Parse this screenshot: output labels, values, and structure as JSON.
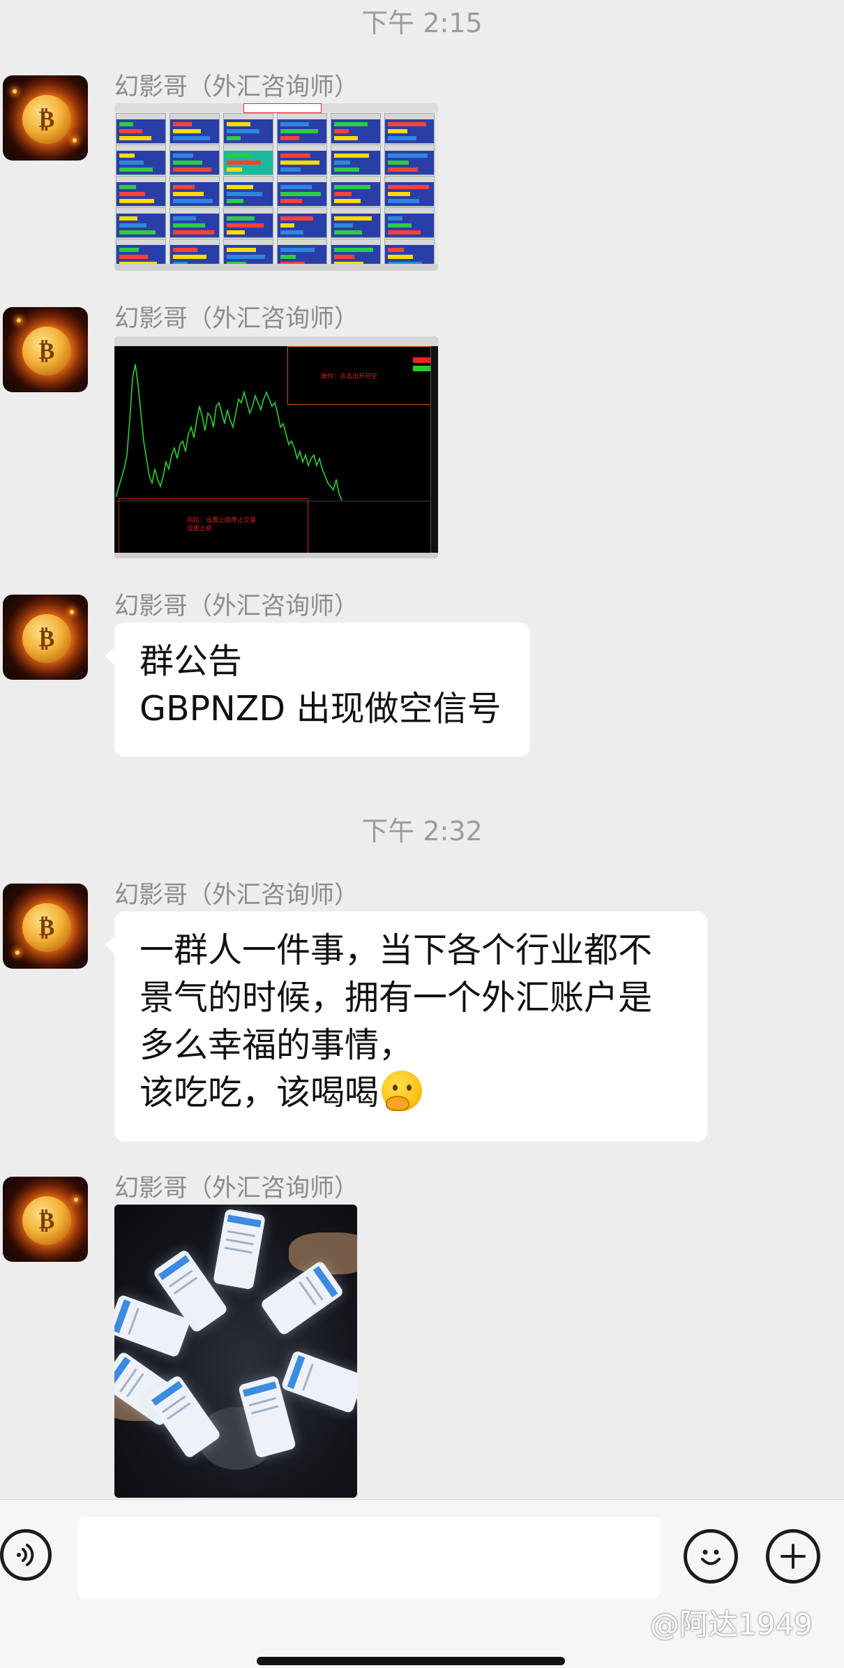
{
  "app": {
    "name": "WeChat group chat"
  },
  "colors": {
    "background": "#ededed",
    "bubble": "#ffffff",
    "timestamp": "#9b9b9b",
    "sender": "#8c8c8c"
  },
  "messages": {
    "ts1": "下午 2:15",
    "ts2": "下午 2:32",
    "sender": "幻影哥（外汇咨询师）",
    "m1": {
      "type": "image",
      "content": "trading dashboard grid screenshot"
    },
    "m2": {
      "type": "image",
      "content": "GBPNZD price chart",
      "note_top": "操作：点击出开开空",
      "note_bottom_line1": "风险：设置止损停止交易",
      "note_bottom_line2": "设置止损"
    },
    "m3": {
      "line1": "群公告",
      "line2": "GBPNZD 出现做空信号"
    },
    "m4": {
      "line1": "一群人一件事，当下各个行业都不",
      "line2": "景气的时候，拥有一个外汇账户是",
      "line3": "多么幸福的事情，",
      "line4": "该吃吃，该喝喝",
      "emoji": "thinking-face"
    },
    "m5": {
      "type": "image",
      "content": "photo of phones in a circle on a table"
    }
  },
  "input_bar": {
    "voice_icon": "voice-icon",
    "emoji_icon": "emoji-icon",
    "plus_icon": "plus-icon",
    "text_value": ""
  },
  "watermark": "@阿达1949"
}
